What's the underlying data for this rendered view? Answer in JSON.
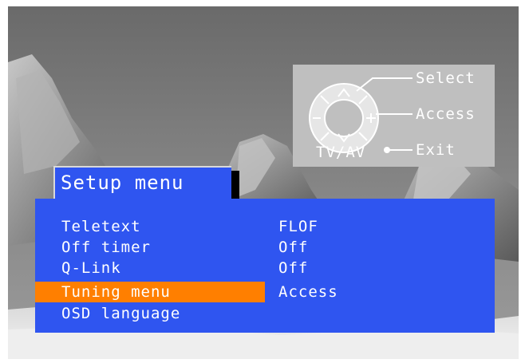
{
  "colors": {
    "menu_blue": "#2f55f0",
    "highlight_orange": "#ff7f00",
    "legend_gray": "#bfbfbf",
    "text_white": "#ffffff"
  },
  "legend": {
    "select_label": "Select",
    "access_label": "Access",
    "exit_label": "Exit",
    "tvav_label": "TV/AV",
    "icons": [
      "up-arrow-icon",
      "down-arrow-icon",
      "minus-icon",
      "plus-icon",
      "dpad-icon",
      "dot-icon"
    ]
  },
  "menu": {
    "title": "Setup menu",
    "selected_index": 3,
    "items": [
      {
        "label": "Teletext",
        "value": "FLOF"
      },
      {
        "label": "Off timer",
        "value": "Off"
      },
      {
        "label": "Q-Link",
        "value": "Off"
      },
      {
        "label": "Tuning menu",
        "value": "Access"
      },
      {
        "label": "OSD language",
        "value": ""
      }
    ]
  }
}
